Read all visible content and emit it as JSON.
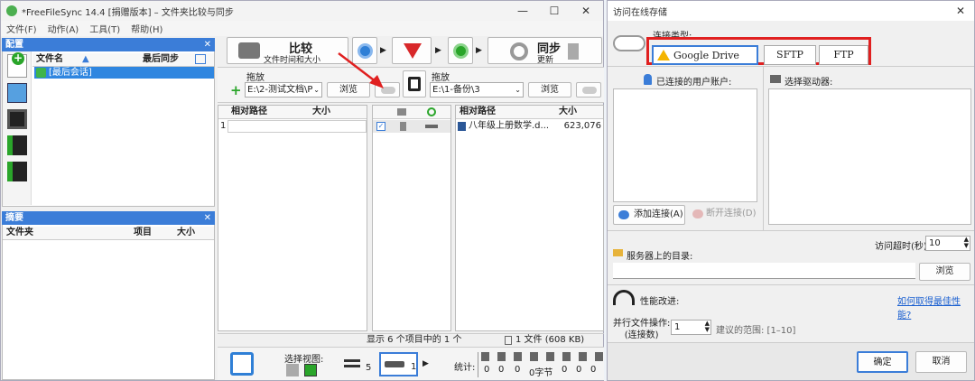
{
  "left_window": {
    "title": "*FreeFileSync 14.4 [捐赠版本] – 文件夹比较与同步",
    "window_controls": [
      "—",
      "☐",
      "✕"
    ],
    "menu": [
      "文件(F)",
      "动作(A)",
      "工具(T)",
      "帮助(H)"
    ],
    "config_panel": {
      "header": "配置",
      "close": "✕",
      "col_name": "文件名",
      "col_last_sync": "最后同步",
      "session": "[最后会话]"
    },
    "summary_panel": {
      "header": "摘要",
      "close": "✕",
      "col_folder": "文件夹",
      "col_items": "项目",
      "col_size": "大小"
    },
    "compare": {
      "label": "比较",
      "sub": "文件时间和大小"
    },
    "sync": {
      "label": "同步",
      "sub": "更新"
    },
    "left_folder": {
      "drop": "拖放",
      "path": "E:\\2-测试文档\\P",
      "browse": "浏览"
    },
    "right_folder": {
      "drop": "拖放",
      "path": "E:\\1-备份\\3",
      "browse": "浏览"
    },
    "left_grid": {
      "col_path": "相对路径",
      "col_size": "大小",
      "row_num": "1"
    },
    "right_grid": {
      "col_path": "相对路径",
      "col_size": "大小",
      "file_name": "八年级上册数学.d...",
      "file_size": "623,076"
    },
    "status": {
      "shown": "显示 6 个项目中的 1 个",
      "files": "1 文件 (608 KB)"
    },
    "bottom": {
      "view_label": "选择视图:",
      "equal_count": "5",
      "diff_count": "1",
      "stats_label": "统计:",
      "stats": [
        "0",
        "0",
        "0",
        "0字节",
        "0",
        "0",
        "0"
      ]
    }
  },
  "dialog": {
    "title": "访问在线存储",
    "close": "✕",
    "connection_type_label": "连接类型:",
    "types": [
      "Google Drive",
      "SFTP",
      "FTP"
    ],
    "accounts_label": "已连接的用户账户:",
    "drives_label": "选择驱动器:",
    "add_connection": "添加连接(A)",
    "disconnect": "断开连接(D)",
    "timeout_label": "访问超时(秒):",
    "timeout_value": "10",
    "server_dir_label": "服务器上的目录:",
    "browse": "浏览",
    "performance_label": "性能改进:",
    "performance_link": "如何取得最佳性能?",
    "parallel_label_1": "并行文件操作:",
    "parallel_label_2": "(连接数)",
    "parallel_value": "1",
    "range_hint": "建议的范围: [1–10]",
    "ok": "确定",
    "cancel": "取消"
  },
  "colors": {
    "accent": "#3b7dd8",
    "highlight": "#e02020",
    "link": "#1a5fd0",
    "selection": "#2f86e0"
  }
}
